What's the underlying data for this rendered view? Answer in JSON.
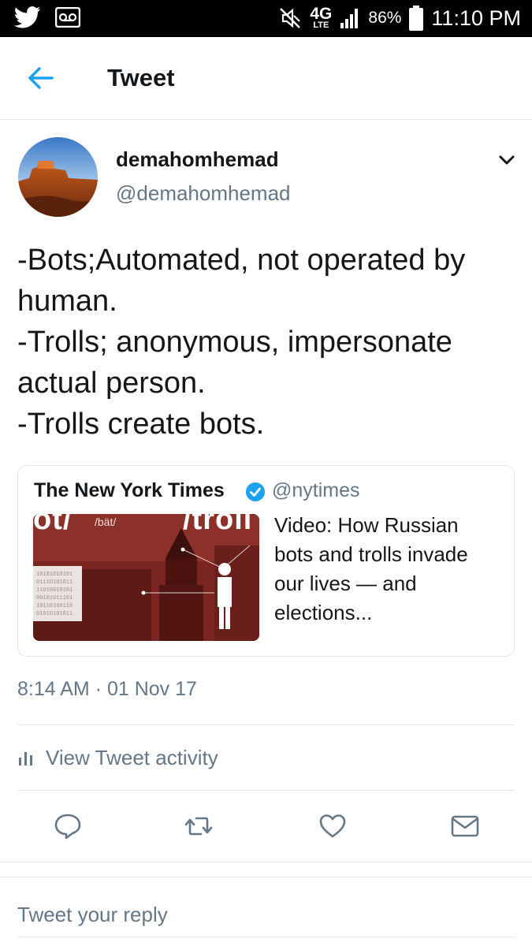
{
  "status_bar": {
    "time": "11:10 PM",
    "battery": "86%",
    "network": "4G",
    "network_sub": "LTE",
    "icons": [
      "twitter-bird-icon",
      "voicemail-icon",
      "mute-icon",
      "signal-icon",
      "battery-icon"
    ]
  },
  "header": {
    "title": "Tweet",
    "back_icon": "back-arrow-icon"
  },
  "tweet": {
    "author": {
      "display_name": "demahomhemad",
      "handle": "@demahomhemad"
    },
    "text_lines": [
      "-Bots;Automated, not operated by",
      "human.",
      "-Trolls; anonymous, impersonate",
      "actual person.",
      "-Trolls create bots."
    ],
    "quoted": {
      "name": "The New York Times",
      "handle": "@nytimes",
      "verified": true,
      "thumb_text_left": "ot/",
      "thumb_text_phonetic": "/bät/",
      "thumb_text_right": "/troll",
      "text_lines": [
        "Video: How Russian",
        "bots and trolls invade",
        "our lives — and",
        "elections..."
      ]
    },
    "timestamp": "8:14 AM · 01 Nov 17"
  },
  "activity": {
    "label": "View Tweet activity",
    "icon": "analytics-bars-icon"
  },
  "actions": [
    {
      "name": "reply",
      "icon": "reply-bubble-icon"
    },
    {
      "name": "retweet",
      "icon": "retweet-icon"
    },
    {
      "name": "like",
      "icon": "heart-icon"
    },
    {
      "name": "dm",
      "icon": "envelope-icon"
    }
  ],
  "reply_box": {
    "placeholder": "Tweet your reply"
  },
  "colors": {
    "accent": "#1da1f2",
    "text": "#14171a",
    "muted": "#657786",
    "divider": "#e1e8ed",
    "action_icon": "#657786"
  }
}
